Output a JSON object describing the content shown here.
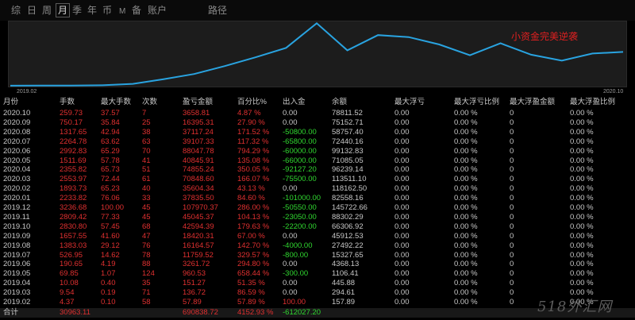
{
  "toolbar": {
    "items": [
      "综",
      "日",
      "周",
      "月",
      "季",
      "年",
      "币",
      "M",
      "备",
      "账户",
      "路径"
    ],
    "active": "月"
  },
  "chart": {
    "start_label": "2019.02",
    "end_label": "2020.10",
    "annotation": "小资金完美逆袭",
    "line_color": "#29a3e0",
    "series": [
      157.89,
      294.61,
      445.88,
      1106.41,
      4368.13,
      15327.65,
      27492.22,
      45912.53,
      66306.92,
      88302.29,
      145722.66,
      82558.16,
      118162.5,
      113511.1,
      96239.14,
      71085.05,
      99132.83,
      72440.16,
      58757.4,
      75152.71,
      78811.52
    ]
  },
  "table": {
    "headers": [
      "月份",
      "手数",
      "最大手数",
      "次数",
      "盈亏金额",
      "百分比%",
      "出入金",
      "余额",
      "最大浮亏",
      "最大浮亏比例",
      "最大浮盈金额",
      "最大浮盈比例"
    ],
    "rows": [
      [
        "2020.10",
        "259.73",
        "37.57",
        "7",
        "3658.81",
        "4.87 %",
        "0.00",
        "78811.52",
        "0.00",
        "0.00 %",
        "0",
        "0.00 %"
      ],
      [
        "2020.09",
        "750.17",
        "35.84",
        "25",
        "16395.31",
        "27.90 %",
        "0.00",
        "75152.71",
        "0.00",
        "0.00 %",
        "0",
        "0.00 %"
      ],
      [
        "2020.08",
        "1317.65",
        "42.94",
        "38",
        "37117.24",
        "171.52 %",
        "-50800.00",
        "58757.40",
        "0.00",
        "0.00 %",
        "0",
        "0.00 %"
      ],
      [
        "2020.07",
        "2264.78",
        "63.62",
        "63",
        "39107.33",
        "117.32 %",
        "-65800.00",
        "72440.16",
        "0.00",
        "0.00 %",
        "0",
        "0.00 %"
      ],
      [
        "2020.06",
        "2992.83",
        "65.29",
        "70",
        "88047.78",
        "794.29 %",
        "-60000.00",
        "99132.83",
        "0.00",
        "0.00 %",
        "0",
        "0.00 %"
      ],
      [
        "2020.05",
        "1511.69",
        "57.78",
        "41",
        "40845.91",
        "135.08 %",
        "-66000.00",
        "71085.05",
        "0.00",
        "0.00 %",
        "0",
        "0.00 %"
      ],
      [
        "2020.04",
        "2355.82",
        "65.73",
        "51",
        "74855.24",
        "350.05 %",
        "-92127.20",
        "96239.14",
        "0.00",
        "0.00 %",
        "0",
        "0.00 %"
      ],
      [
        "2020.03",
        "2553.97",
        "72.44",
        "61",
        "70848.60",
        "166.07 %",
        "-75500.00",
        "113511.10",
        "0.00",
        "0.00 %",
        "0",
        "0.00 %"
      ],
      [
        "2020.02",
        "1893.73",
        "65.23",
        "40",
        "35604.34",
        "43.13 %",
        "0.00",
        "118162.50",
        "0.00",
        "0.00 %",
        "0",
        "0.00 %"
      ],
      [
        "2020.01",
        "2233.82",
        "76.06",
        "33",
        "37835.50",
        "84.60 %",
        "-101000.00",
        "82558.16",
        "0.00",
        "0.00 %",
        "0",
        "0.00 %"
      ],
      [
        "2019.12",
        "3236.68",
        "100.00",
        "45",
        "107970.37",
        "286.00 %",
        "-50550.00",
        "145722.66",
        "0.00",
        "0.00 %",
        "0",
        "0.00 %"
      ],
      [
        "2019.11",
        "2809.42",
        "77.33",
        "45",
        "45045.37",
        "104.13 %",
        "-23050.00",
        "88302.29",
        "0.00",
        "0.00 %",
        "0",
        "0.00 %"
      ],
      [
        "2019.10",
        "2830.80",
        "57.45",
        "68",
        "42594.39",
        "179.63 %",
        "-22200.00",
        "66306.92",
        "0.00",
        "0.00 %",
        "0",
        "0.00 %"
      ],
      [
        "2019.09",
        "1657.55",
        "41.60",
        "47",
        "18420.31",
        "67.00 %",
        "0.00",
        "45912.53",
        "0.00",
        "0.00 %",
        "0",
        "0.00 %"
      ],
      [
        "2019.08",
        "1383.03",
        "29.12",
        "76",
        "16164.57",
        "142.70 %",
        "-4000.00",
        "27492.22",
        "0.00",
        "0.00 %",
        "0",
        "0.00 %"
      ],
      [
        "2019.07",
        "526.95",
        "14.62",
        "78",
        "11759.52",
        "329.57 %",
        "-800.00",
        "15327.65",
        "0.00",
        "0.00 %",
        "0",
        "0.00 %"
      ],
      [
        "2019.06",
        "190.65",
        "4.19",
        "88",
        "3261.72",
        "294.80 %",
        "0.00",
        "4368.13",
        "0.00",
        "0.00 %",
        "0",
        "0.00 %"
      ],
      [
        "2019.05",
        "69.85",
        "1.07",
        "124",
        "960.53",
        "658.44 %",
        "-300.00",
        "1106.41",
        "0.00",
        "0.00 %",
        "0",
        "0.00 %"
      ],
      [
        "2019.04",
        "10.08",
        "0.40",
        "35",
        "151.27",
        "51.35 %",
        "0.00",
        "445.88",
        "0.00",
        "0.00 %",
        "0",
        "0.00 %"
      ],
      [
        "2019.03",
        "9.54",
        "0.19",
        "71",
        "136.72",
        "86.59 %",
        "0.00",
        "294.61",
        "0.00",
        "0.00 %",
        "0",
        "0.00 %"
      ],
      [
        "2019.02",
        "4.37",
        "0.10",
        "58",
        "57.89",
        "57.89 %",
        "100.00",
        "157.89",
        "0.00",
        "0.00 %",
        "0",
        "0.00 %"
      ]
    ],
    "total": [
      "合计",
      "30963.11",
      "",
      "",
      "690838.72",
      "4152.93 %",
      "-612027.20",
      "",
      "",
      "",
      "",
      ""
    ]
  },
  "colors": {
    "profit": "#e03030",
    "outflow": "#30d830",
    "neutral": "#c8c8c8"
  },
  "watermark": "518外汇网"
}
